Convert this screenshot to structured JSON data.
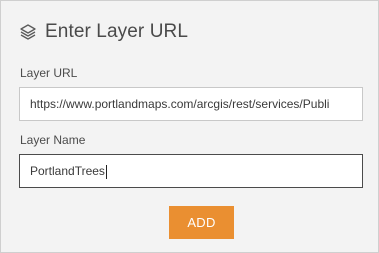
{
  "dialog": {
    "title": "Enter Layer URL",
    "icon": "layers-icon"
  },
  "form": {
    "url_label": "Layer URL",
    "url_value": "https://www.portlandmaps.com/arcgis/rest/services/Publi",
    "name_label": "Layer Name",
    "name_value": "PortlandTrees",
    "add_label": "ADD"
  },
  "colors": {
    "accent": "#ea8f31",
    "panel_background": "#f3f3f3",
    "focused_border": "#4b4b4b"
  }
}
